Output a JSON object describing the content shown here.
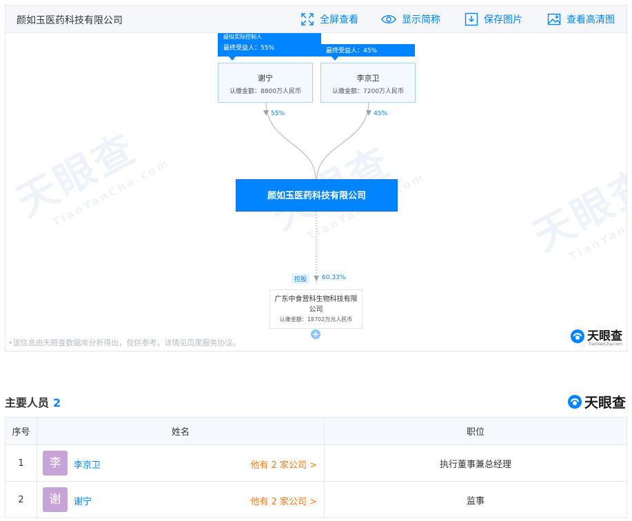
{
  "header": {
    "title": "颜如玉医药科技有限公司",
    "tools": [
      {
        "label": "全屏查看",
        "icon": "fullscreen-icon"
      },
      {
        "label": "显示简称",
        "icon": "eye-icon"
      },
      {
        "label": "保存图片",
        "icon": "download-icon"
      },
      {
        "label": "查看高清图",
        "icon": "image-icon"
      }
    ]
  },
  "chart": {
    "shareholders": [
      {
        "tag_extra": "疑似实际控制人",
        "tag": "最终受益人：55%",
        "name": "谢宁",
        "amount": "认缴金额：8800万人民币",
        "pct": "55%"
      },
      {
        "tag": "最终受益人：45%",
        "name": "李京卫",
        "amount": "认缴金额：7200万人民币",
        "pct": "45%"
      }
    ],
    "company": "颜如玉医药科技有限公司",
    "subsidiary": {
      "control_tag": "控股",
      "pct": "60.33%",
      "name": "广东中食营科生物科技有限公司",
      "amount": "认缴金额：18702万元人民币"
    },
    "note": "该信息由天眼查数据库分析得出，仅供参考，详情见页尾服务协议。",
    "watermark": "天眼查",
    "watermark_sub": "TianYanCha.com",
    "brand": "天眼查",
    "brand_sub": "TianYanCha.com"
  },
  "personnel": {
    "title": "主要人员",
    "count": "2",
    "brand": "天眼查",
    "headers": [
      "序号",
      "姓名",
      "职位"
    ],
    "rows": [
      {
        "index": "1",
        "avatar": "李",
        "name": "李京卫",
        "other": "他有 2 家公司 >",
        "position": "执行董事兼总经理"
      },
      {
        "index": "2",
        "avatar": "谢",
        "name": "谢宁",
        "other": "他有 2 家公司 >",
        "position": "监事"
      }
    ]
  },
  "colors": {
    "accent": "#0084ff",
    "orange": "#ff7a1a",
    "avatar": "#c7a4d8"
  }
}
